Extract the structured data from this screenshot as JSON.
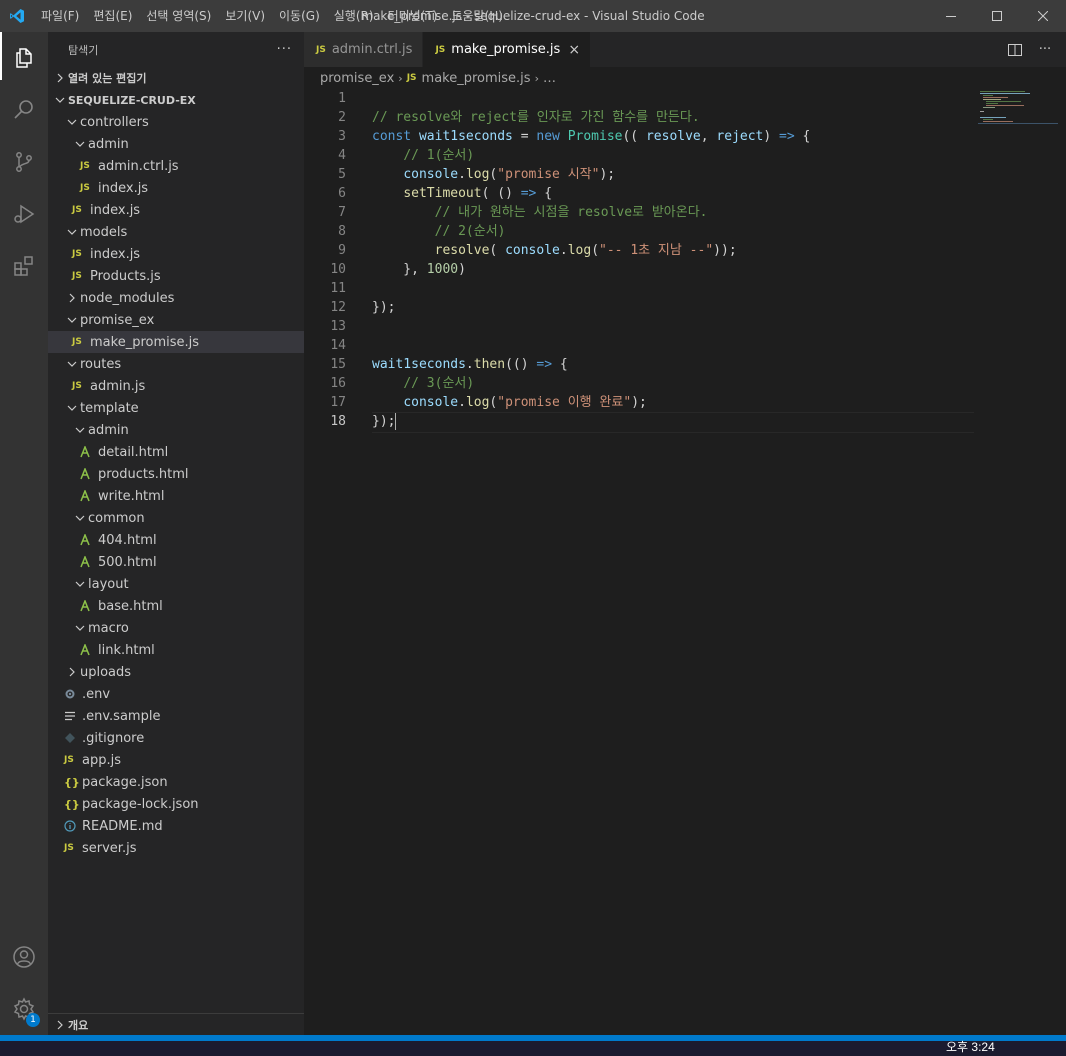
{
  "window": {
    "title": "make_promise.js - sequelize-crud-ex - Visual Studio Code",
    "menu": [
      "파일(F)",
      "편집(E)",
      "선택 영역(S)",
      "보기(V)",
      "이동(G)",
      "실행(R)",
      "터미널(T)",
      "도움말(H)"
    ]
  },
  "activity_bar": {
    "items": [
      "explorer-icon",
      "search-icon",
      "source-control-icon",
      "run-debug-icon",
      "extensions-icon"
    ],
    "bottom": [
      "accounts-icon",
      "manage-gear-icon"
    ],
    "manage_badge": "1"
  },
  "sidebar": {
    "title": "탐색기",
    "more": "···",
    "open_editors": "열려 있는 편집기",
    "project": "SEQUELIZE-CRUD-EX",
    "outline": "개요",
    "tree": [
      {
        "label": "controllers",
        "type": "folder",
        "open": true,
        "depth": 1
      },
      {
        "label": "admin",
        "type": "folder",
        "open": true,
        "depth": 2
      },
      {
        "label": "admin.ctrl.js",
        "type": "js",
        "depth": 3
      },
      {
        "label": "index.js",
        "type": "js",
        "depth": 3
      },
      {
        "label": "index.js",
        "type": "js",
        "depth": 2
      },
      {
        "label": "models",
        "type": "folder",
        "open": true,
        "depth": 1
      },
      {
        "label": "index.js",
        "type": "js",
        "depth": 2
      },
      {
        "label": "Products.js",
        "type": "js",
        "depth": 2
      },
      {
        "label": "node_modules",
        "type": "folder",
        "open": false,
        "depth": 1
      },
      {
        "label": "promise_ex",
        "type": "folder",
        "open": true,
        "depth": 1
      },
      {
        "label": "make_promise.js",
        "type": "js",
        "depth": 2,
        "selected": true
      },
      {
        "label": "routes",
        "type": "folder",
        "open": true,
        "depth": 1
      },
      {
        "label": "admin.js",
        "type": "js",
        "depth": 2
      },
      {
        "label": "template",
        "type": "folder",
        "open": true,
        "depth": 1
      },
      {
        "label": "admin",
        "type": "folder",
        "open": true,
        "depth": 2
      },
      {
        "label": "detail.html",
        "type": "nunjucks",
        "depth": 3
      },
      {
        "label": "products.html",
        "type": "nunjucks",
        "depth": 3
      },
      {
        "label": "write.html",
        "type": "nunjucks",
        "depth": 3
      },
      {
        "label": "common",
        "type": "folder",
        "open": true,
        "depth": 2
      },
      {
        "label": "404.html",
        "type": "nunjucks",
        "depth": 3
      },
      {
        "label": "500.html",
        "type": "nunjucks",
        "depth": 3
      },
      {
        "label": "layout",
        "type": "folder",
        "open": true,
        "depth": 2
      },
      {
        "label": "base.html",
        "type": "nunjucks",
        "depth": 3
      },
      {
        "label": "macro",
        "type": "folder",
        "open": true,
        "depth": 2
      },
      {
        "label": "link.html",
        "type": "nunjucks",
        "depth": 3
      },
      {
        "label": "uploads",
        "type": "folder",
        "open": false,
        "depth": 1
      },
      {
        "label": ".env",
        "type": "gear",
        "depth": 1
      },
      {
        "label": ".env.sample",
        "type": "lines",
        "depth": 1
      },
      {
        "label": ".gitignore",
        "type": "git",
        "depth": 1
      },
      {
        "label": "app.js",
        "type": "js",
        "depth": 1
      },
      {
        "label": "package.json",
        "type": "json",
        "depth": 1
      },
      {
        "label": "package-lock.json",
        "type": "json",
        "depth": 1
      },
      {
        "label": "README.md",
        "type": "info",
        "depth": 1
      },
      {
        "label": "server.js",
        "type": "js",
        "depth": 1
      }
    ]
  },
  "editor": {
    "tabs": [
      {
        "label": "admin.ctrl.js",
        "active": false
      },
      {
        "label": "make_promise.js",
        "active": true
      }
    ],
    "breadcrumb": [
      "promise_ex",
      "make_promise.js",
      "…"
    ],
    "current_line": 18,
    "lines": [
      [],
      [
        [
          "cm",
          "// resolve와 reject를 인자로 가진 함수를 만든다."
        ]
      ],
      [
        [
          "kw",
          "const "
        ],
        [
          "vr",
          "wait1seconds"
        ],
        [
          "pl",
          " = "
        ],
        [
          "kw",
          "new "
        ],
        [
          "cl",
          "Promise"
        ],
        [
          "pl",
          "(( "
        ],
        [
          "vr",
          "resolve"
        ],
        [
          "pl",
          ", "
        ],
        [
          "vr",
          "reject"
        ],
        [
          "pl",
          ") "
        ],
        [
          "kw",
          "=>"
        ],
        [
          "pl",
          " {"
        ]
      ],
      [
        [
          "pl",
          "    "
        ],
        [
          "cm",
          "// 1(순서)"
        ]
      ],
      [
        [
          "pl",
          "    "
        ],
        [
          "vr",
          "console"
        ],
        [
          "pl",
          "."
        ],
        [
          "fn",
          "log"
        ],
        [
          "pl",
          "("
        ],
        [
          "st",
          "\"promise 시작\""
        ],
        [
          "pl",
          ");"
        ]
      ],
      [
        [
          "pl",
          "    "
        ],
        [
          "fn",
          "setTimeout"
        ],
        [
          "pl",
          "( () "
        ],
        [
          "kw",
          "=>"
        ],
        [
          "pl",
          " {"
        ]
      ],
      [
        [
          "pl",
          "        "
        ],
        [
          "cm",
          "// 내가 원하는 시점을 resolve로 받아온다."
        ]
      ],
      [
        [
          "pl",
          "        "
        ],
        [
          "cm",
          "// 2(순서)"
        ]
      ],
      [
        [
          "pl",
          "        "
        ],
        [
          "fn",
          "resolve"
        ],
        [
          "pl",
          "( "
        ],
        [
          "vr",
          "console"
        ],
        [
          "pl",
          "."
        ],
        [
          "fn",
          "log"
        ],
        [
          "pl",
          "("
        ],
        [
          "st",
          "\"-- 1초 지남 --\""
        ],
        [
          "pl",
          "));"
        ]
      ],
      [
        [
          "pl",
          "    }, "
        ],
        [
          "nm",
          "1000"
        ],
        [
          "pl",
          ")"
        ]
      ],
      [],
      [
        [
          "pl",
          "});"
        ]
      ],
      [],
      [],
      [
        [
          "vr",
          "wait1seconds"
        ],
        [
          "pl",
          "."
        ],
        [
          "fn",
          "then"
        ],
        [
          "pl",
          "(() "
        ],
        [
          "kw",
          "=>"
        ],
        [
          "pl",
          " {"
        ]
      ],
      [
        [
          "pl",
          "    "
        ],
        [
          "cm",
          "// 3(순서)"
        ]
      ],
      [
        [
          "pl",
          "    "
        ],
        [
          "vr",
          "console"
        ],
        [
          "pl",
          "."
        ],
        [
          "fn",
          "log"
        ],
        [
          "pl",
          "("
        ],
        [
          "st",
          "\"promise 이행 완료\""
        ],
        [
          "pl",
          ");"
        ]
      ],
      [
        [
          "pl",
          "});"
        ]
      ]
    ]
  },
  "taskbar": {
    "clock": "오후 3:24"
  }
}
